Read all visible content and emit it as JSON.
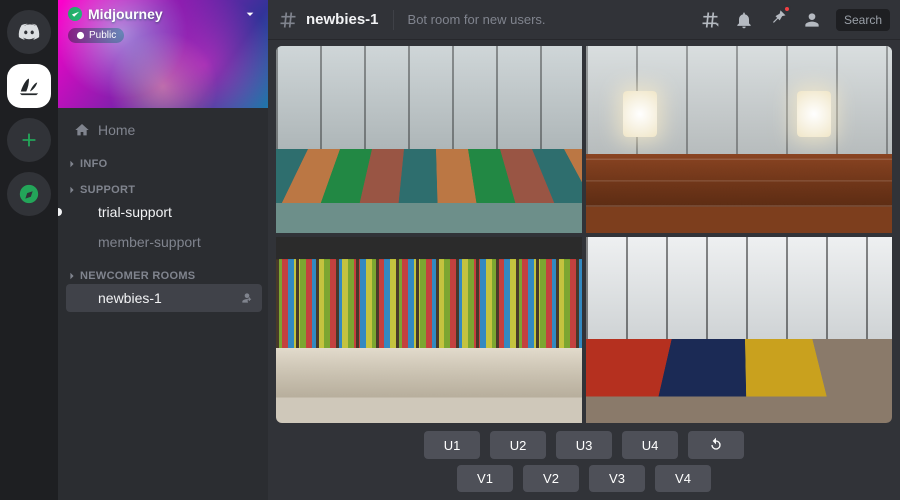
{
  "server": {
    "name": "Midjourney",
    "public_label": "Public"
  },
  "sidebar": {
    "home_label": "Home",
    "categories": [
      {
        "name": "INFO",
        "channels": []
      },
      {
        "name": "SUPPORT",
        "channels": [
          {
            "label": "trial-support",
            "unread": true
          },
          {
            "label": "member-support",
            "unread": false
          }
        ]
      },
      {
        "name": "NEWCOMER ROOMS",
        "channels": [
          {
            "label": "newbies-1",
            "selected": true
          }
        ]
      }
    ]
  },
  "header": {
    "channel": "newbies-1",
    "topic": "Bot room for new users.",
    "search_placeholder": "Search"
  },
  "actions": {
    "row1": [
      "U1",
      "U2",
      "U3",
      "U4"
    ],
    "row2": [
      "V1",
      "V2",
      "V3",
      "V4"
    ],
    "refresh_name": "refresh"
  }
}
